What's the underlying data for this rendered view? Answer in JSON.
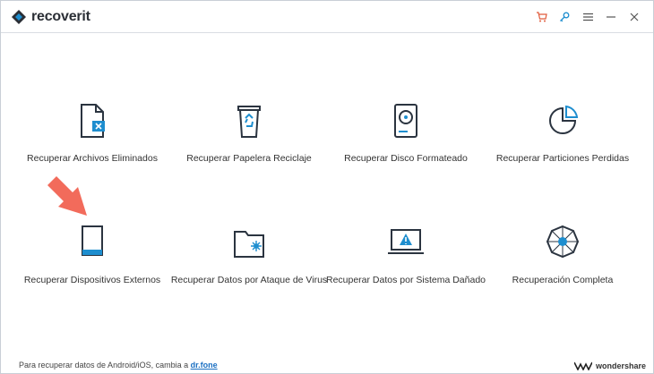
{
  "app": {
    "title_part1": "recover",
    "title_part2": "it"
  },
  "toolbar": {
    "icons": [
      "cart-icon",
      "key-icon",
      "menu-icon",
      "minimize-icon",
      "close-icon"
    ],
    "accent": "#e05a3a",
    "blue": "#1e8ecf"
  },
  "tiles": [
    {
      "label": "Recuperar Archivos Eliminados",
      "icon": "deleted-file-icon"
    },
    {
      "label": "Recuperar Papelera Reciclaje",
      "icon": "recycle-bin-icon"
    },
    {
      "label": "Recuperar Disco Formateado",
      "icon": "formatted-disk-icon"
    },
    {
      "label": "Recuperar Particiones Perdidas",
      "icon": "lost-partition-icon"
    },
    {
      "label": "Recuperar Dispositivos Externos",
      "icon": "external-device-icon"
    },
    {
      "label": "Recuperar Datos por Ataque de Virus",
      "icon": "virus-attack-icon"
    },
    {
      "label": "Recuperar Datos por Sistema Dañado",
      "icon": "crashed-system-icon"
    },
    {
      "label": "Recuperación Completa",
      "icon": "all-around-recovery-icon"
    }
  ],
  "footer": {
    "text": "Para recuperar datos de Android/iOS, cambia a ",
    "link": "dr.fone"
  },
  "brand": {
    "name": "wondershare"
  }
}
